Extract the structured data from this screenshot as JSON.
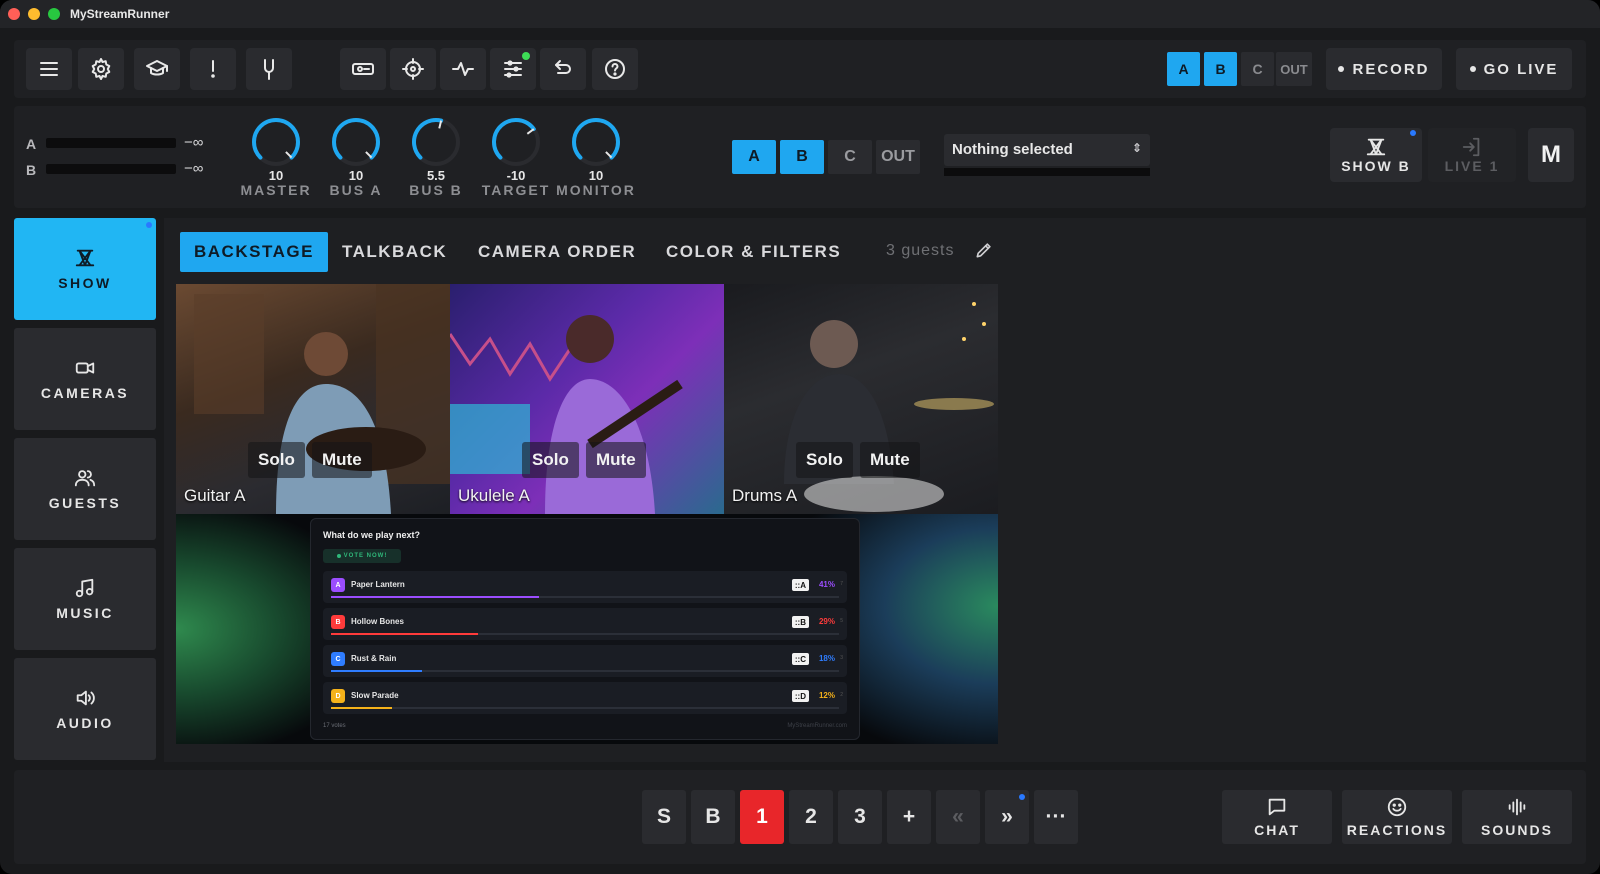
{
  "app": {
    "title": "MyStreamRunner"
  },
  "toolbar": {
    "icons": [
      "menu-icon",
      "gear-icon",
      "graduation-cap-icon",
      "alert-icon",
      "tuning-fork-icon",
      "stream-key-icon",
      "crosshair-icon",
      "pulse-icon",
      "sliders-icon",
      "undo-icon",
      "help-icon"
    ],
    "output_selector": [
      "A",
      "B",
      "C",
      "OUT"
    ],
    "output_active": [
      "A",
      "B"
    ],
    "record_label": "RECORD",
    "go_live_label": "GO LIVE"
  },
  "mixer": {
    "meters": [
      {
        "label": "A",
        "value": "−∞"
      },
      {
        "label": "B",
        "value": "−∞"
      }
    ],
    "knobs": [
      {
        "value": "10",
        "label": "MASTER",
        "level": 1.0
      },
      {
        "value": "10",
        "label": "BUS A",
        "level": 1.0
      },
      {
        "value": "5.5",
        "label": "BUS B",
        "level": 0.55
      },
      {
        "value": "-10",
        "label": "TARGET",
        "level": 0.7
      },
      {
        "value": "10",
        "label": "MONITOR",
        "level": 1.0
      }
    ],
    "bus_selector": [
      "A",
      "B",
      "C",
      "OUT"
    ],
    "bus_active": [
      "A",
      "B"
    ],
    "source_select": "Nothing selected",
    "scene_buttons": [
      {
        "label": "SHOW B",
        "icon": "show-icon"
      },
      {
        "label": "LIVE 1",
        "icon": "enter-icon"
      },
      {
        "label": "M"
      }
    ]
  },
  "sidebar": {
    "items": [
      {
        "label": "SHOW",
        "icon": "show-icon"
      },
      {
        "label": "CAMERAS",
        "icon": "camera-icon"
      },
      {
        "label": "GUESTS",
        "icon": "users-icon"
      },
      {
        "label": "MUSIC",
        "icon": "music-icon"
      },
      {
        "label": "AUDIO",
        "icon": "speaker-icon"
      }
    ]
  },
  "tabs": {
    "items": [
      "BACKSTAGE",
      "TALKBACK",
      "CAMERA ORDER",
      "COLOR & FILTERS"
    ],
    "active": "BACKSTAGE",
    "guests_count": "3 guests"
  },
  "guests": [
    {
      "name": "Guitar A",
      "solo": "Solo",
      "mute": "Mute"
    },
    {
      "name": "Ukulele A",
      "solo": "Solo",
      "mute": "Mute"
    },
    {
      "name": "Drums A",
      "solo": "Solo",
      "mute": "Mute"
    }
  ],
  "poll": {
    "title": "What do we play next?",
    "badge": "VOTE NOW!",
    "options": [
      {
        "letter": "A",
        "name": "Paper Lantern",
        "code": "::A",
        "pct": "41%",
        "n": "7",
        "fraction": 0.41,
        "color": "#9b4dff"
      },
      {
        "letter": "B",
        "name": "Hollow Bones",
        "code": "::B",
        "pct": "29%",
        "n": "5",
        "fraction": 0.29,
        "color": "#ff3b3b"
      },
      {
        "letter": "C",
        "name": "Rust & Rain",
        "code": "::C",
        "pct": "18%",
        "n": "3",
        "fraction": 0.18,
        "color": "#2f7dff"
      },
      {
        "letter": "D",
        "name": "Slow Parade",
        "code": "::D",
        "pct": "12%",
        "n": "2",
        "fraction": 0.12,
        "color": "#f5b21a"
      }
    ],
    "footer_left": "17 votes",
    "footer_right": "MyStreamRunner.com"
  },
  "bottom_bar": {
    "buttons": [
      "S",
      "B",
      "1",
      "2",
      "3",
      "+",
      "«",
      "»",
      "···"
    ],
    "active": "1",
    "actions": [
      {
        "label": "CHAT",
        "icon": "chat-icon"
      },
      {
        "label": "REACTIONS",
        "icon": "smile-icon"
      },
      {
        "label": "SOUNDS",
        "icon": "waveform-icon"
      }
    ]
  },
  "colors": {
    "accent": "#1fa7f0",
    "live": "#e8262a",
    "panel": "#1f2023",
    "button": "#2a2b2f"
  }
}
